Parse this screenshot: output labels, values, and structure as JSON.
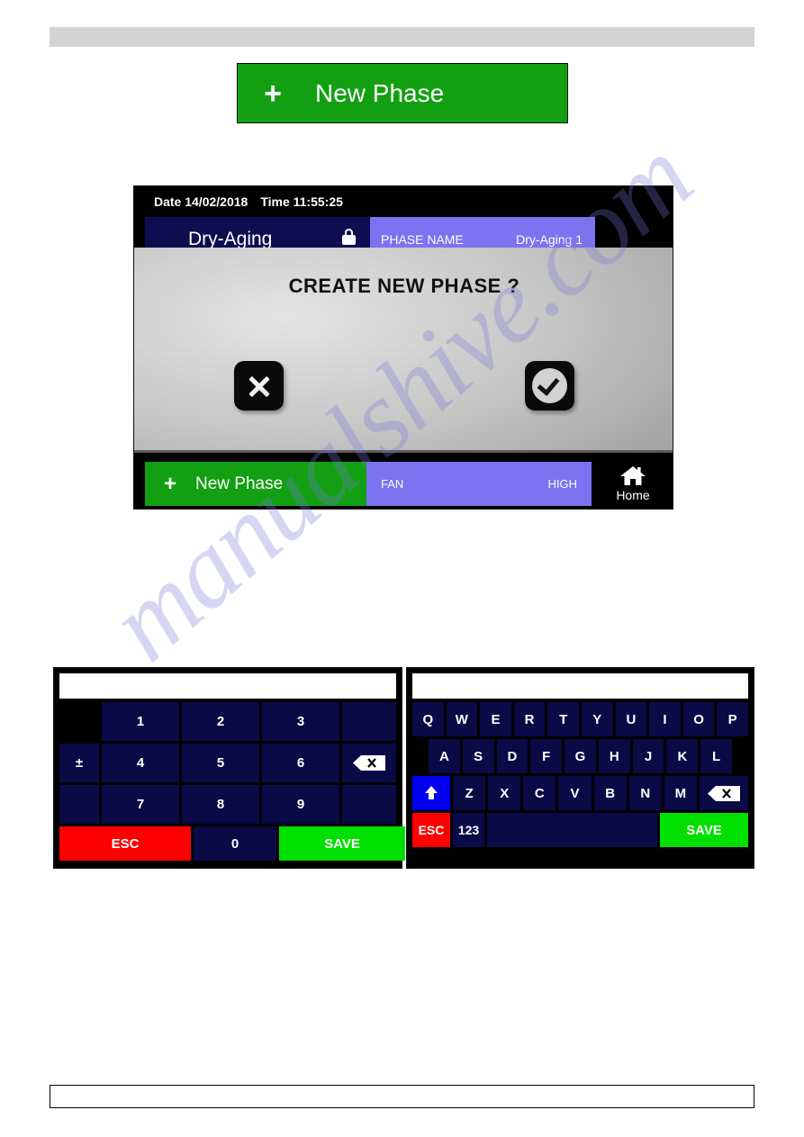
{
  "page": {
    "watermark": "manualshive.com"
  },
  "hero_button": {
    "icon": "plus-icon",
    "plus": "+",
    "label": "New Phase"
  },
  "device": {
    "status_bar": {
      "date_label": "Date 14/02/2018",
      "time_label": "Time 11:55:25"
    },
    "mode_bar": {
      "mode": "Dry-Aging",
      "lock_icon": "lock-icon"
    },
    "phase_name_panel": {
      "label": "PHASE NAME",
      "value": "Dry-Aging 1"
    },
    "dialog": {
      "title": "CREATE NEW PHASE ?",
      "cancel_icon": "close-icon",
      "confirm_icon": "check-circle-icon"
    },
    "bottom_bar": {
      "new_phase": {
        "plus": "+",
        "label": "New Phase"
      },
      "fan": {
        "label": "FAN",
        "value": "HIGH"
      },
      "home": {
        "icon": "home-icon",
        "label": "Home"
      }
    }
  },
  "numeric_keypad": {
    "display_value": "",
    "keys": {
      "plus_minus": "±",
      "row1": [
        "1",
        "2",
        "3"
      ],
      "row2": [
        "4",
        "5",
        "6"
      ],
      "row3": [
        "7",
        "8",
        "9"
      ],
      "backspace_icon": "backspace-icon",
      "esc": "ESC",
      "zero": "0",
      "save": "SAVE"
    }
  },
  "qwerty_keypad": {
    "display_value": "",
    "keys": {
      "row1": [
        "Q",
        "W",
        "E",
        "R",
        "T",
        "Y",
        "U",
        "I",
        "O",
        "P"
      ],
      "row2": [
        "A",
        "S",
        "D",
        "F",
        "G",
        "H",
        "J",
        "K",
        "L"
      ],
      "row3": [
        "Z",
        "X",
        "C",
        "V",
        "B",
        "N",
        "M"
      ],
      "shift_icon": "shift-arrow-icon",
      "backspace_icon": "backspace-icon",
      "esc": "ESC",
      "numeric_mode": "123",
      "space": "",
      "save": "SAVE"
    }
  },
  "colors": {
    "green": "#12a012",
    "save_green": "#00e000",
    "red": "#ff0000",
    "key_navy": "#0a0a46",
    "panel_purple": "#7b73f0",
    "mode_navy": "#0d0d50",
    "shift_blue": "#0000ee",
    "header_gray": "#d3d3d3"
  }
}
